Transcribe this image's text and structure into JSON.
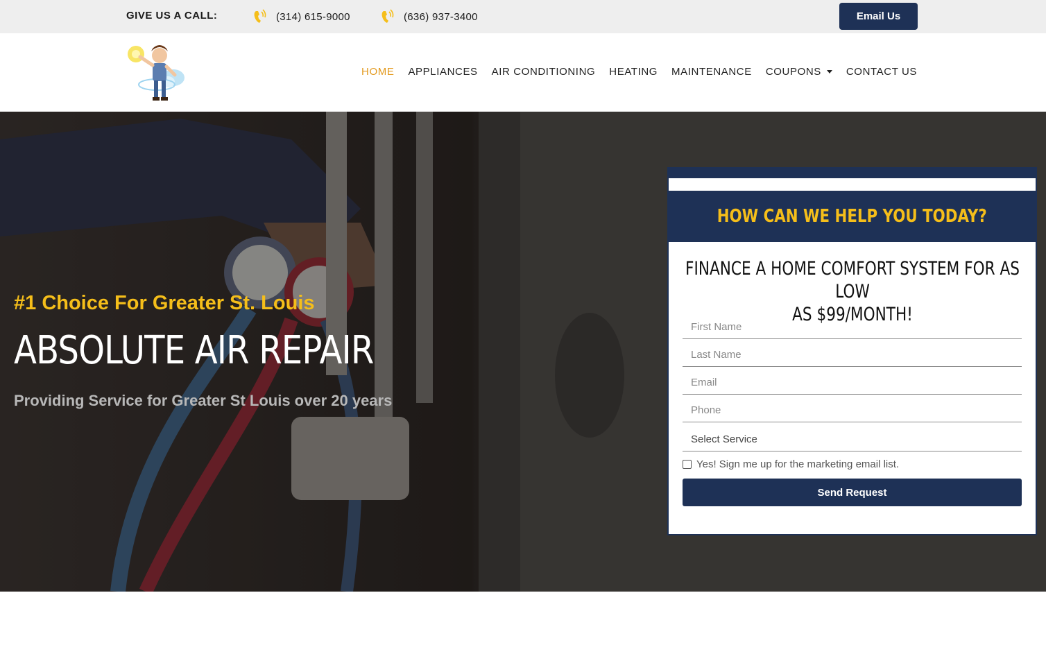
{
  "topbar": {
    "call_label": "GIVE US A CALL:",
    "phones": [
      {
        "number": "(314) 615-9000",
        "icon": "phone-ringing-icon"
      },
      {
        "number": "(636) 937-3400",
        "icon": "phone-ringing-icon"
      }
    ],
    "email_button": "Email Us"
  },
  "header": {
    "logo": "technician-mascot-logo",
    "nav": [
      {
        "label": "HOME",
        "active": true
      },
      {
        "label": "APPLIANCES",
        "active": false
      },
      {
        "label": "AIR CONDITIONING",
        "active": false
      },
      {
        "label": "HEATING",
        "active": false
      },
      {
        "label": "MAINTENANCE",
        "active": false
      },
      {
        "label": "COUPONS",
        "active": false,
        "dropdown": true
      },
      {
        "label": "CONTACT US",
        "active": false
      }
    ]
  },
  "hero": {
    "tagline": "#1 Choice For Greater St. Louis",
    "headline": "ABSOLUTE AIR REPAIR",
    "subline": "Providing Service for Greater St Louis over 20 years"
  },
  "form": {
    "title": "HOW CAN WE HELP YOU TODAY?",
    "finance_line1": "FINANCE A HOME COMFORT SYSTEM FOR AS LOW",
    "finance_line2": "AS $99/MONTH!",
    "fields": {
      "first_name": "First Name",
      "last_name": "Last Name",
      "email": "Email",
      "phone": "Phone"
    },
    "select_service": "Select Service",
    "checkbox_label": "Yes! Sign me up for the marketing email list.",
    "submit": "Send Request"
  },
  "colors": {
    "navy": "#1e3156",
    "gold": "#f5be1a",
    "nav_active": "#e39a1f",
    "topbar_bg": "#eeeeee"
  }
}
